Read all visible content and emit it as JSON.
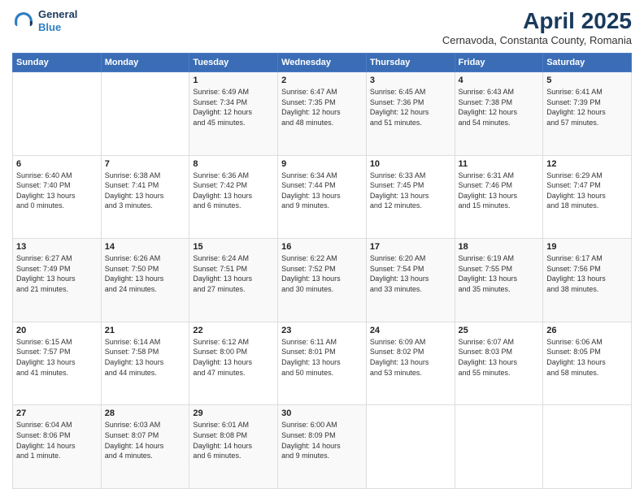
{
  "header": {
    "logo_general": "General",
    "logo_blue": "Blue",
    "month_title": "April 2025",
    "location": "Cernavoda, Constanta County, Romania"
  },
  "days_of_week": [
    "Sunday",
    "Monday",
    "Tuesday",
    "Wednesday",
    "Thursday",
    "Friday",
    "Saturday"
  ],
  "weeks": [
    [
      {
        "day": "",
        "info": ""
      },
      {
        "day": "",
        "info": ""
      },
      {
        "day": "1",
        "info": "Sunrise: 6:49 AM\nSunset: 7:34 PM\nDaylight: 12 hours\nand 45 minutes."
      },
      {
        "day": "2",
        "info": "Sunrise: 6:47 AM\nSunset: 7:35 PM\nDaylight: 12 hours\nand 48 minutes."
      },
      {
        "day": "3",
        "info": "Sunrise: 6:45 AM\nSunset: 7:36 PM\nDaylight: 12 hours\nand 51 minutes."
      },
      {
        "day": "4",
        "info": "Sunrise: 6:43 AM\nSunset: 7:38 PM\nDaylight: 12 hours\nand 54 minutes."
      },
      {
        "day": "5",
        "info": "Sunrise: 6:41 AM\nSunset: 7:39 PM\nDaylight: 12 hours\nand 57 minutes."
      }
    ],
    [
      {
        "day": "6",
        "info": "Sunrise: 6:40 AM\nSunset: 7:40 PM\nDaylight: 13 hours\nand 0 minutes."
      },
      {
        "day": "7",
        "info": "Sunrise: 6:38 AM\nSunset: 7:41 PM\nDaylight: 13 hours\nand 3 minutes."
      },
      {
        "day": "8",
        "info": "Sunrise: 6:36 AM\nSunset: 7:42 PM\nDaylight: 13 hours\nand 6 minutes."
      },
      {
        "day": "9",
        "info": "Sunrise: 6:34 AM\nSunset: 7:44 PM\nDaylight: 13 hours\nand 9 minutes."
      },
      {
        "day": "10",
        "info": "Sunrise: 6:33 AM\nSunset: 7:45 PM\nDaylight: 13 hours\nand 12 minutes."
      },
      {
        "day": "11",
        "info": "Sunrise: 6:31 AM\nSunset: 7:46 PM\nDaylight: 13 hours\nand 15 minutes."
      },
      {
        "day": "12",
        "info": "Sunrise: 6:29 AM\nSunset: 7:47 PM\nDaylight: 13 hours\nand 18 minutes."
      }
    ],
    [
      {
        "day": "13",
        "info": "Sunrise: 6:27 AM\nSunset: 7:49 PM\nDaylight: 13 hours\nand 21 minutes."
      },
      {
        "day": "14",
        "info": "Sunrise: 6:26 AM\nSunset: 7:50 PM\nDaylight: 13 hours\nand 24 minutes."
      },
      {
        "day": "15",
        "info": "Sunrise: 6:24 AM\nSunset: 7:51 PM\nDaylight: 13 hours\nand 27 minutes."
      },
      {
        "day": "16",
        "info": "Sunrise: 6:22 AM\nSunset: 7:52 PM\nDaylight: 13 hours\nand 30 minutes."
      },
      {
        "day": "17",
        "info": "Sunrise: 6:20 AM\nSunset: 7:54 PM\nDaylight: 13 hours\nand 33 minutes."
      },
      {
        "day": "18",
        "info": "Sunrise: 6:19 AM\nSunset: 7:55 PM\nDaylight: 13 hours\nand 35 minutes."
      },
      {
        "day": "19",
        "info": "Sunrise: 6:17 AM\nSunset: 7:56 PM\nDaylight: 13 hours\nand 38 minutes."
      }
    ],
    [
      {
        "day": "20",
        "info": "Sunrise: 6:15 AM\nSunset: 7:57 PM\nDaylight: 13 hours\nand 41 minutes."
      },
      {
        "day": "21",
        "info": "Sunrise: 6:14 AM\nSunset: 7:58 PM\nDaylight: 13 hours\nand 44 minutes."
      },
      {
        "day": "22",
        "info": "Sunrise: 6:12 AM\nSunset: 8:00 PM\nDaylight: 13 hours\nand 47 minutes."
      },
      {
        "day": "23",
        "info": "Sunrise: 6:11 AM\nSunset: 8:01 PM\nDaylight: 13 hours\nand 50 minutes."
      },
      {
        "day": "24",
        "info": "Sunrise: 6:09 AM\nSunset: 8:02 PM\nDaylight: 13 hours\nand 53 minutes."
      },
      {
        "day": "25",
        "info": "Sunrise: 6:07 AM\nSunset: 8:03 PM\nDaylight: 13 hours\nand 55 minutes."
      },
      {
        "day": "26",
        "info": "Sunrise: 6:06 AM\nSunset: 8:05 PM\nDaylight: 13 hours\nand 58 minutes."
      }
    ],
    [
      {
        "day": "27",
        "info": "Sunrise: 6:04 AM\nSunset: 8:06 PM\nDaylight: 14 hours\nand 1 minute."
      },
      {
        "day": "28",
        "info": "Sunrise: 6:03 AM\nSunset: 8:07 PM\nDaylight: 14 hours\nand 4 minutes."
      },
      {
        "day": "29",
        "info": "Sunrise: 6:01 AM\nSunset: 8:08 PM\nDaylight: 14 hours\nand 6 minutes."
      },
      {
        "day": "30",
        "info": "Sunrise: 6:00 AM\nSunset: 8:09 PM\nDaylight: 14 hours\nand 9 minutes."
      },
      {
        "day": "",
        "info": ""
      },
      {
        "day": "",
        "info": ""
      },
      {
        "day": "",
        "info": ""
      }
    ]
  ]
}
